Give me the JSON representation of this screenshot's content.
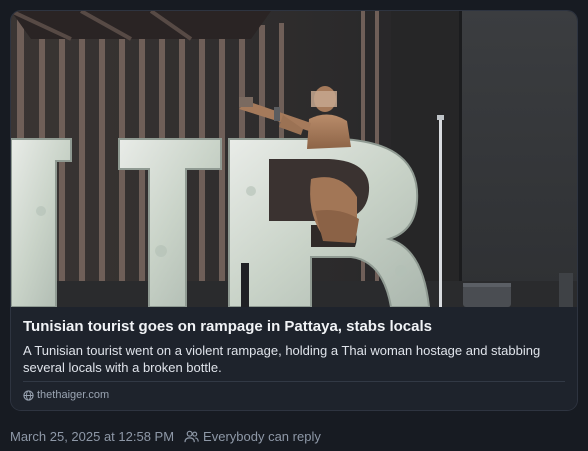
{
  "link_card": {
    "title": "Tunisian tourist goes on rampage in Pattaya, stabs locals",
    "description": "A Tunisian tourist went on a violent rampage, holding a Thai woman hostage and stabbing several locals with a broken bottle.",
    "domain": "thethaiger.com",
    "domain_icon": "globe-icon"
  },
  "post_meta": {
    "timestamp": "March 25, 2025 at 12:58 PM",
    "reply_setting": "Everybody can reply",
    "reply_icon": "people-icon"
  },
  "colors": {
    "background": "#171b22",
    "card": "#1e232c",
    "border": "#2e3440",
    "text_primary": "#f1f3f6",
    "text_muted": "#8e98a7"
  }
}
